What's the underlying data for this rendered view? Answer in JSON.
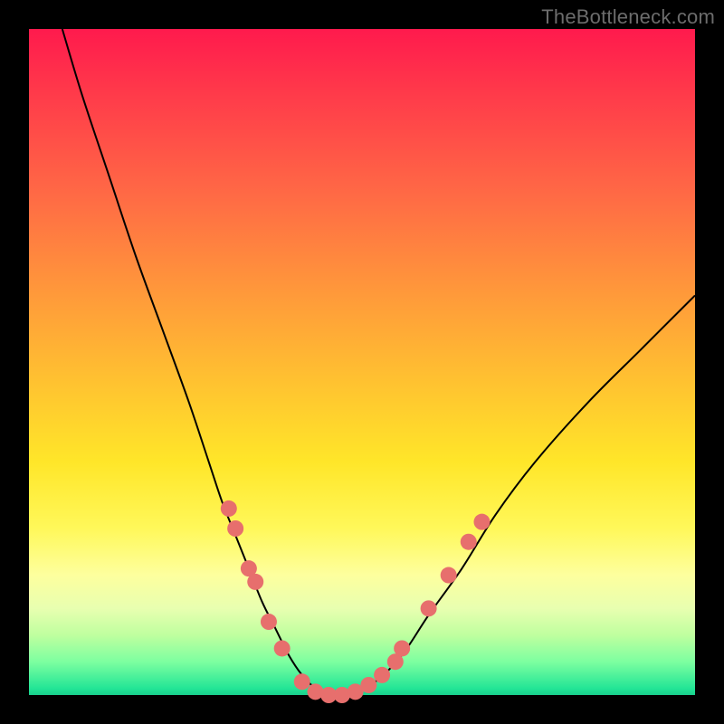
{
  "watermark": "TheBottleneck.com",
  "colors": {
    "frame": "#000000",
    "dot": "#e76f6d",
    "curve": "#000000",
    "gradient_top": "#ff1a4d",
    "gradient_bottom": "#19cf8d"
  },
  "chart_data": {
    "type": "line",
    "title": "",
    "xlabel": "",
    "ylabel": "",
    "xlim": [
      0,
      100
    ],
    "ylim": [
      0,
      100
    ],
    "series": [
      {
        "name": "bottleneck-curve",
        "x": [
          5,
          8,
          12,
          16,
          20,
          24,
          27,
          29,
          31,
          33,
          35,
          37,
          39,
          41,
          43,
          45,
          48,
          52,
          56,
          60,
          65,
          70,
          76,
          84,
          92,
          100
        ],
        "y": [
          100,
          90,
          78,
          66,
          55,
          44,
          35,
          29,
          24,
          19,
          14,
          10,
          6,
          3,
          1,
          0,
          0,
          2,
          6,
          12,
          19,
          27,
          35,
          44,
          52,
          60
        ]
      }
    ],
    "markers": {
      "name": "dots",
      "points": [
        {
          "x": 30,
          "y": 28
        },
        {
          "x": 31,
          "y": 25
        },
        {
          "x": 33,
          "y": 19
        },
        {
          "x": 34,
          "y": 17
        },
        {
          "x": 36,
          "y": 11
        },
        {
          "x": 38,
          "y": 7
        },
        {
          "x": 41,
          "y": 2
        },
        {
          "x": 43,
          "y": 0.5
        },
        {
          "x": 45,
          "y": 0
        },
        {
          "x": 47,
          "y": 0
        },
        {
          "x": 49,
          "y": 0.5
        },
        {
          "x": 51,
          "y": 1.5
        },
        {
          "x": 53,
          "y": 3
        },
        {
          "x": 55,
          "y": 5
        },
        {
          "x": 56,
          "y": 7
        },
        {
          "x": 60,
          "y": 13
        },
        {
          "x": 63,
          "y": 18
        },
        {
          "x": 66,
          "y": 23
        },
        {
          "x": 68,
          "y": 26
        }
      ]
    }
  }
}
